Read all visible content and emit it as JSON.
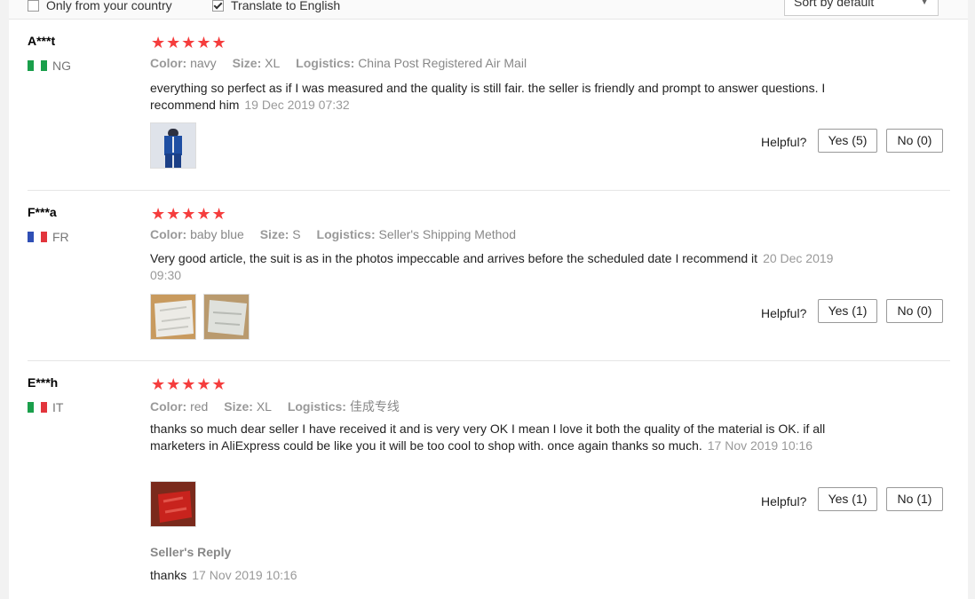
{
  "filters": {
    "only_country": "Only from your country",
    "translate": "Translate to English",
    "sort": "Sort by default"
  },
  "labels": {
    "color": "Color:",
    "size": "Size:",
    "logistics": "Logistics:",
    "helpful": "Helpful?",
    "seller_reply": "Seller's Reply"
  },
  "reviews": [
    {
      "user": "A***t",
      "country": "NG",
      "stars": "★★★★★",
      "color": "navy",
      "size": "XL",
      "logistics": "China Post Registered Air Mail",
      "text": "everything so perfect as if I was measured and the quality is still fair. the seller is friendly and prompt to answer questions. I recommend him",
      "date": "19 Dec 2019 07:32",
      "yes": "Yes (5)",
      "no": "No (0)"
    },
    {
      "user": "F***a",
      "country": "FR",
      "stars": "★★★★★",
      "color": "baby blue",
      "size": "S",
      "logistics": "Seller's Shipping Method",
      "text": "Very good article, the suit is as in the photos impeccable and arrives before the scheduled date I recommend it",
      "date": "20 Dec 2019 09:30",
      "yes": "Yes (1)",
      "no": "No (0)"
    },
    {
      "user": "E***h",
      "country": "IT",
      "stars": "★★★★★",
      "color": "red",
      "size": "XL",
      "logistics": "佳成专线",
      "text": "thanks so much dear seller I have received it and is very very OK I mean I love it both the quality of the material is OK. if all marketers in AliExpress could be like you it will be too cool to shop with. once again thanks so much.",
      "date": "17 Nov 2019 10:16",
      "yes": "Yes (1)",
      "no": "No (1)",
      "reply_text": "thanks",
      "reply_date": "17 Nov 2019 10:16"
    }
  ],
  "colors": {
    "star": "#f53d3d",
    "flag_ng": [
      "#1a9f4b",
      "#ffffff",
      "#1a9f4b"
    ],
    "flag_fr": [
      "#2f4fb5",
      "#ffffff",
      "#e2353c"
    ],
    "flag_it": [
      "#1a9f4b",
      "#ffffff",
      "#e2353c"
    ]
  }
}
